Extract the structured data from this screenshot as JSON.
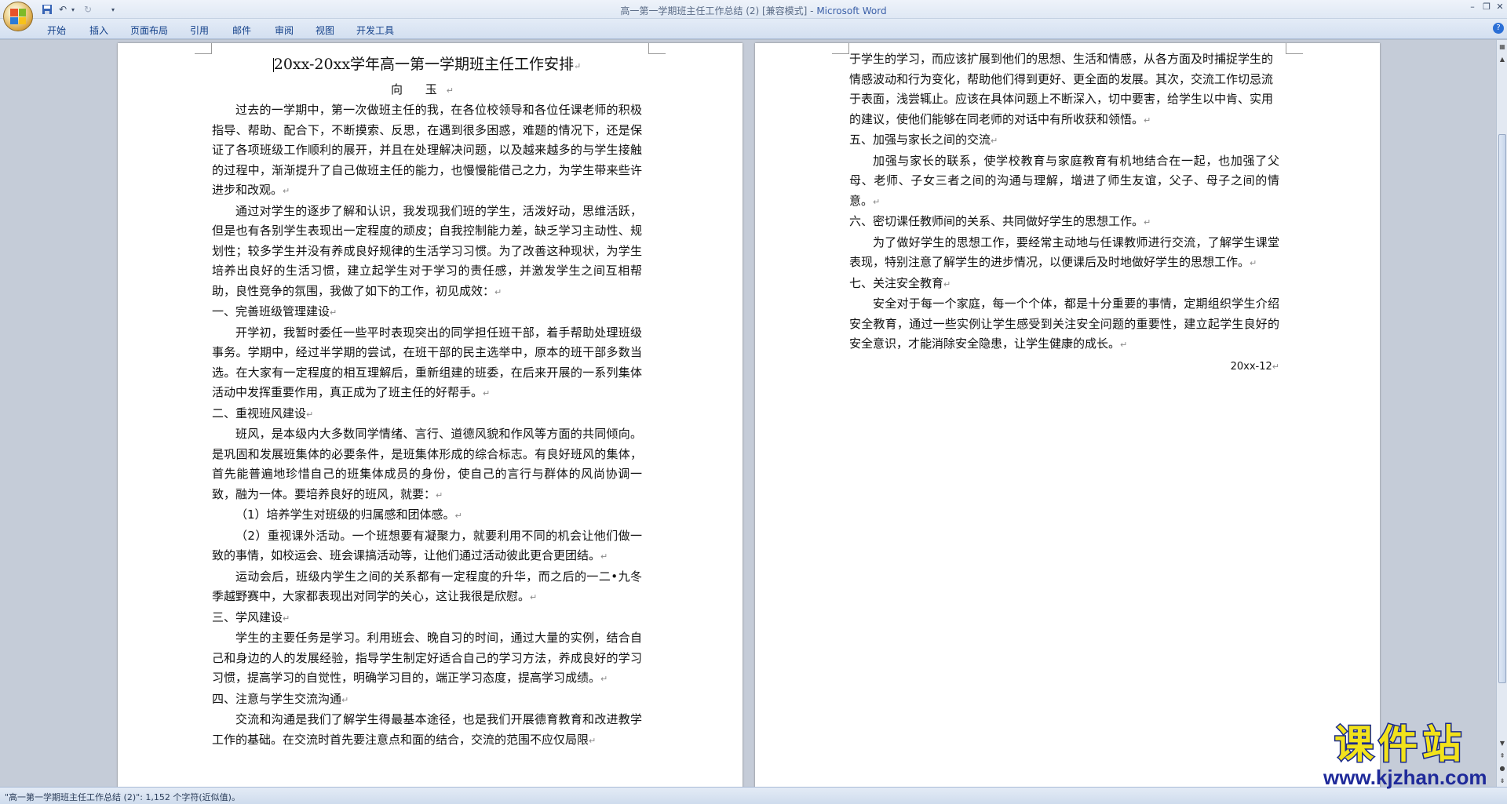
{
  "window": {
    "title_doc": "高一第一学期班主任工作总结 (2) [兼容模式] - ",
    "title_app": "Microsoft Word"
  },
  "ribbon": {
    "tabs": [
      "开始",
      "插入",
      "页面布局",
      "引用",
      "邮件",
      "审阅",
      "视图",
      "开发工具"
    ]
  },
  "document": {
    "title": "20xx-20xx学年高一第一学期班主任工作安排",
    "author": "向 玉",
    "page1": [
      {
        "type": "para",
        "text": "过去的一学期中，第一次做班主任的我，在各位校领导和各位任课老师的积极指导、帮助、配合下，不断摸索、反思，在遇到很多困惑，难题的情况下，还是保证了各项班级工作顺利的展开，并且在处理解决问题，以及越来越多的与学生接触的过程中，渐渐提升了自己做班主任的能力，也慢慢能借己之力，为学生带来些许进步和改观。"
      },
      {
        "type": "para",
        "text": "通过对学生的逐步了解和认识，我发现我们班的学生，活泼好动，思维活跃，但是也有各别学生表现出一定程度的顽皮；自我控制能力差，缺乏学习主动性、规划性；较多学生并没有养成良好规律的生活学习习惯。为了改善这种现状，为学生培养出良好的生活习惯，建立起学生对于学习的责任感，并激发学生之间互相帮助，良性竞争的氛围，我做了如下的工作，初见成效："
      },
      {
        "type": "heading",
        "text": "一、完善班级管理建设"
      },
      {
        "type": "para",
        "text": "开学初，我暂时委任一些平时表现突出的同学担任班干部，着手帮助处理班级事务。学期中，经过半学期的尝试，在班干部的民主选举中，原本的班干部多数当选。在大家有一定程度的相互理解后，重新组建的班委，在后来开展的一系列集体活动中发挥重要作用，真正成为了班主任的好帮手。"
      },
      {
        "type": "heading",
        "text": "二、重视班风建设"
      },
      {
        "type": "para",
        "text": "班风，是本级内大多数同学情绪、言行、道德风貌和作风等方面的共同倾向。是巩固和发展班集体的必要条件，是班集体形成的综合标志。有良好班风的集体，首先能普遍地珍惜自己的班集体成员的身份，使自己的言行与群体的风尚协调一致，融为一体。要培养良好的班风，就要："
      },
      {
        "type": "para",
        "text": "（1）培养学生对班级的归属感和团体感。"
      },
      {
        "type": "para",
        "text": "（2）重视课外活动。一个班想要有凝聚力，就要利用不同的机会让他们做一致的事情，如校运会、班会课搞活动等，让他们通过活动彼此更合更团结。"
      },
      {
        "type": "para",
        "text": "运动会后，班级内学生之间的关系都有一定程度的升华，而之后的一二•九冬季越野赛中，大家都表现出对同学的关心，这让我很是欣慰。"
      },
      {
        "type": "heading",
        "text": "三、学风建设"
      },
      {
        "type": "para",
        "text": "学生的主要任务是学习。利用班会、晚自习的时间，通过大量的实例，结合自己和身边的人的发展经验，指导学生制定好适合自己的学习方法，养成良好的学习习惯，提高学习的自觉性，明确学习目的，端正学习态度，提高学习成绩。"
      },
      {
        "type": "heading",
        "text": "四、注意与学生交流沟通"
      },
      {
        "type": "para",
        "text": "交流和沟通是我们了解学生得最基本途径，也是我们开展德育教育和改进教学工作的基础。在交流时首先要注意点和面的结合，交流的范围不应仅局限"
      }
    ],
    "page2": [
      {
        "type": "noind",
        "text": "于学生的学习，而应该扩展到他们的思想、生活和情感，从各方面及时捕捉学生的情感波动和行为变化，帮助他们得到更好、更全面的发展。其次，交流工作切忌流于表面，浅尝辄止。应该在具体问题上不断深入，切中要害，给学生以中肯、实用的建议，使他们能够在同老师的对话中有所收获和领悟。"
      },
      {
        "type": "heading",
        "text": "五、加强与家长之间的交流"
      },
      {
        "type": "para",
        "text": "加强与家长的联系，使学校教育与家庭教育有机地结合在一起，也加强了父母、老师、子女三者之间的沟通与理解，增进了师生友谊，父子、母子之间的情意。"
      },
      {
        "type": "heading",
        "text": "六、密切课任教师间的关系、共同做好学生的思想工作。"
      },
      {
        "type": "para",
        "text": "为了做好学生的思想工作，要经常主动地与任课教师进行交流，了解学生课堂表现，特别注意了解学生的进步情况，以便课后及时地做好学生的思想工作。"
      },
      {
        "type": "heading",
        "text": "七、关注安全教育"
      },
      {
        "type": "para",
        "text": "安全对于每一个家庭，每一个个体，都是十分重要的事情，定期组织学生介绍安全教育，通过一些实例让学生感受到关注安全问题的重要性，建立起学生良好的安全意识，才能消除安全隐患，让学生健康的成长。"
      },
      {
        "type": "date",
        "text": "20xx-12"
      }
    ]
  },
  "statusbar": {
    "text": "\"高一第一学期班主任工作总结 (2)\": 1,152 个字符(近似值)。"
  },
  "watermark": {
    "logo_text": "课件站",
    "url": "www.kjzhan.com"
  },
  "colors": {
    "ribbon_text": "#15428b",
    "watermark_fill": "#f2e21a",
    "watermark_stroke": "#1a2a8c"
  }
}
